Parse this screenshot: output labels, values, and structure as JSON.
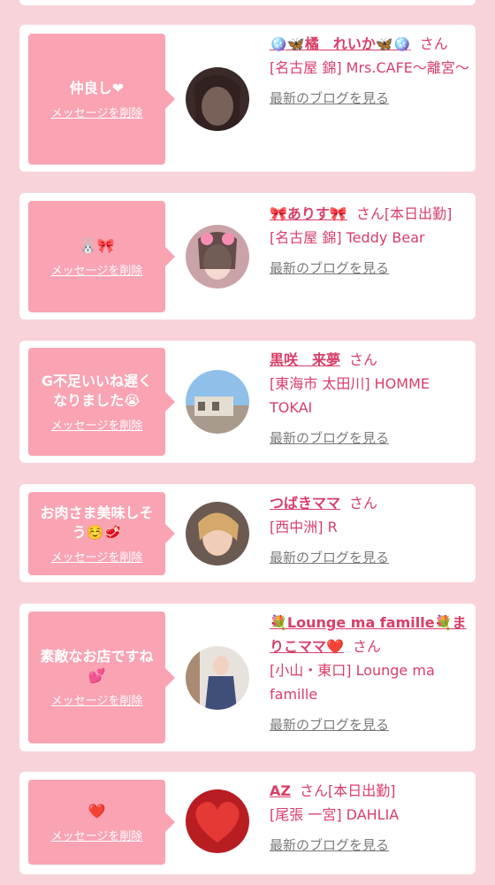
{
  "messages": [
    {
      "message": "仲良し❤",
      "delete_label": "メッセージを削除",
      "name": "🪩🦋橘　れいか🦋🪩",
      "suffix": "さん",
      "shop": "[名古屋 錦] Mrs.CAFE〜離宮〜",
      "blog_label": "最新のブログを見る"
    },
    {
      "message": "🐰🎀",
      "delete_label": "メッセージを削除",
      "name": "🎀ありす🎀",
      "suffix": "さん[本日出勤]",
      "shop": "[名古屋 錦] Teddy Bear",
      "blog_label": "最新のブログを見る"
    },
    {
      "message": "G不足いいね遅くなりました😭",
      "delete_label": "メッセージを削除",
      "name": "黒咲　来夢",
      "suffix": "さん",
      "shop": "[東海市 太田川] HOMME TOKAI",
      "blog_label": "最新のブログを見る"
    },
    {
      "message": "お肉さま美味しそう☺️🥩",
      "delete_label": "メッセージを削除",
      "name": "つばきママ",
      "suffix": "さん",
      "shop": "[西中洲] R",
      "blog_label": "最新のブログを見る"
    },
    {
      "message": "素敵なお店ですね💕",
      "delete_label": "メッセージを削除",
      "name": "💐Lounge ma famille💐まりこママ❤️",
      "suffix": "さん",
      "shop": "[小山・東口] Lounge ma famille",
      "blog_label": "最新のブログを見る"
    },
    {
      "message": "❤️",
      "delete_label": "メッセージを削除",
      "name": "AZ",
      "suffix": "さん[本日出勤]",
      "shop": "[尾張 一宮] DAHLIA",
      "blog_label": "最新のブログを見る"
    }
  ]
}
